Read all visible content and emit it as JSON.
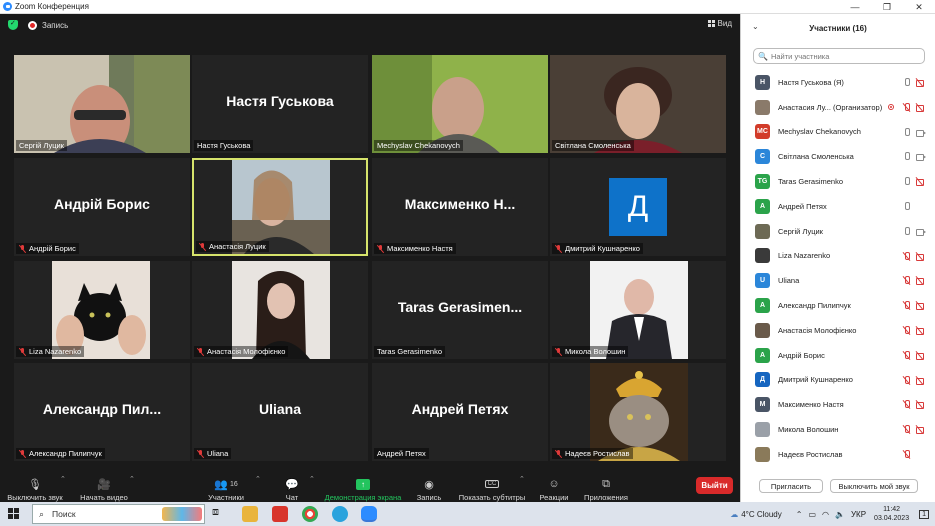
{
  "window": {
    "title": "Zoom Конференция"
  },
  "top": {
    "record_label": "Запись",
    "view_label": "Вид"
  },
  "tiles": [
    {
      "name": "Сергій Луцик",
      "video": true,
      "muted": false
    },
    {
      "name": "Настя Гуськова",
      "video": false,
      "muted": false,
      "display": "Настя Гуськова"
    },
    {
      "name": "Mechyslav Chekanovych",
      "video": true,
      "muted": false
    },
    {
      "name": "Світлана Смоленська",
      "video": true,
      "muted": false
    },
    {
      "name": "Андрій Борис",
      "video": false,
      "muted": true,
      "display": "Андрій Борис"
    },
    {
      "name": "Анастасія Луцик",
      "video": true,
      "muted": true,
      "active": true
    },
    {
      "name": "Максименко Настя",
      "video": false,
      "muted": true,
      "display": "Максименко Н..."
    },
    {
      "name": "Дмитрий Кушнаренко",
      "video": false,
      "muted": true,
      "avatar": "Д"
    },
    {
      "name": "Liza Nazarenko",
      "video": true,
      "muted": true
    },
    {
      "name": "Анастасія Молофієнко",
      "video": true,
      "muted": true
    },
    {
      "name": "Taras Gerasimenko",
      "video": false,
      "muted": false,
      "display": "Taras Gerasimen..."
    },
    {
      "name": "Микола Волошин",
      "video": true,
      "muted": true
    },
    {
      "name": "Александр Пилипчук",
      "video": false,
      "muted": true,
      "display": "Александр Пил..."
    },
    {
      "name": "Uliana",
      "video": false,
      "muted": true,
      "display": "Uliana"
    },
    {
      "name": "Андрей Петях",
      "video": false,
      "muted": false,
      "display": "Андрей Петях"
    },
    {
      "name": "Надеєв Ростислав",
      "video": true,
      "muted": true
    }
  ],
  "toolbar": {
    "mute": "Выключить звук",
    "video": "Начать видео",
    "participants": "Участники",
    "participants_count": "16",
    "chat": "Чат",
    "share": "Демонстрация экрана",
    "record": "Запись",
    "subtitles": "Показать субтитры",
    "subtitles_icon": "CC",
    "reactions": "Реакции",
    "apps": "Приложения",
    "leave": "Выйти"
  },
  "panel": {
    "title": "Участники (16)",
    "search_placeholder": "Найти участника",
    "participants": [
      {
        "initials": "Н",
        "color": "#4a5566",
        "name": "Настя Гуськова (Я)",
        "mic": "on",
        "cam": "off"
      },
      {
        "initials": "",
        "color": "#8a7a6a",
        "name": "Анастасия Лу... (Организатор)",
        "mic": "off",
        "cam": "off",
        "rec": true,
        "photo": true
      },
      {
        "initials": "MC",
        "color": "#d23c2a",
        "name": "Mechyslav Chekanovych",
        "mic": "on",
        "cam": "on"
      },
      {
        "initials": "С",
        "color": "#2b86d9",
        "name": "Світлана Смоленська",
        "mic": "on",
        "cam": "on"
      },
      {
        "initials": "TG",
        "color": "#2ba34a",
        "name": "Taras Gerasimenko",
        "mic": "on",
        "cam": "off"
      },
      {
        "initials": "А",
        "color": "#2ba34a",
        "name": "Андрей Петях",
        "mic": "on",
        "cam": "none"
      },
      {
        "initials": "",
        "color": "#6d6a55",
        "name": "Сергій Луцик",
        "mic": "on",
        "cam": "on",
        "photo": true
      },
      {
        "initials": "",
        "color": "#3a3a3a",
        "name": "Liza Nazarenko",
        "mic": "off",
        "cam": "off",
        "photo": true
      },
      {
        "initials": "U",
        "color": "#2b86d9",
        "name": "Uliana",
        "mic": "off",
        "cam": "off"
      },
      {
        "initials": "А",
        "color": "#2ba34a",
        "name": "Александр Пилипчук",
        "mic": "off",
        "cam": "off"
      },
      {
        "initials": "",
        "color": "#6a5a4a",
        "name": "Анастасія Молофієнко",
        "mic": "off",
        "cam": "off",
        "photo": true
      },
      {
        "initials": "А",
        "color": "#2ba34a",
        "name": "Андрій Борис",
        "mic": "off",
        "cam": "off"
      },
      {
        "initials": "Д",
        "color": "#1565c0",
        "name": "Дмитрий Кушнаренко",
        "mic": "off",
        "cam": "off"
      },
      {
        "initials": "М",
        "color": "#4a5566",
        "name": "Максименко Настя",
        "mic": "off",
        "cam": "off"
      },
      {
        "initials": "",
        "color": "#9aa0a8",
        "name": "Микола Волошин",
        "mic": "off",
        "cam": "off",
        "photo": true
      },
      {
        "initials": "",
        "color": "#8a7a5a",
        "name": "Надеєв Ростислав",
        "mic": "off",
        "cam": "none",
        "photo": true
      }
    ],
    "invite": "Пригласить",
    "mute_me": "Выключить мой звук"
  },
  "taskbar": {
    "search": "Поиск",
    "weather": "4°C  Cloudy",
    "lang": "УКР",
    "time": "11:42",
    "date": "03.04.2023",
    "notif": "1"
  },
  "colors": {
    "accent": "#2d8cff",
    "leave": "#d92a2a",
    "share": "#23c45e",
    "active_border": "#d6e36b"
  }
}
